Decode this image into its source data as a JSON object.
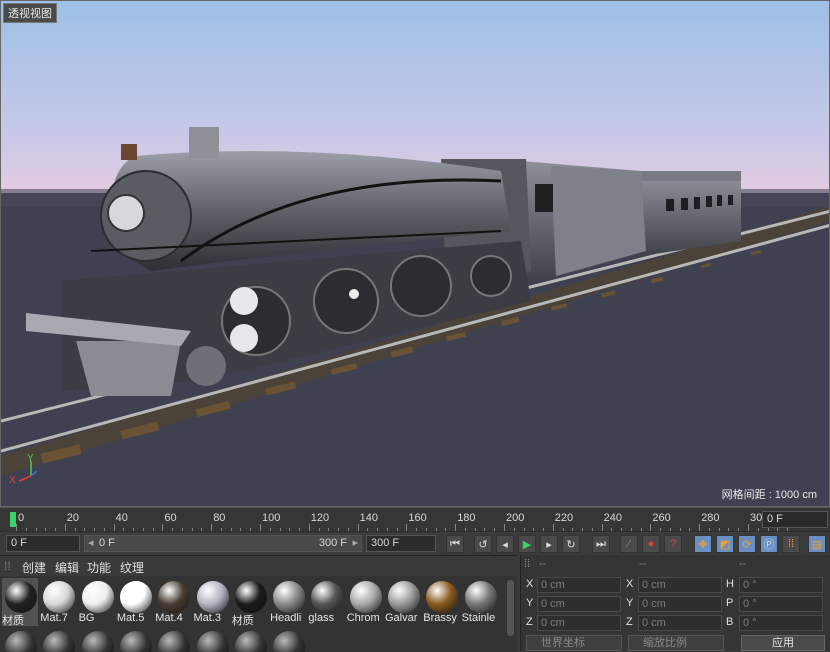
{
  "viewport": {
    "tab_label": "透视视图",
    "grid_spacing": "网格间距 : 1000 cm",
    "axis_x": "X",
    "axis_y": "Y",
    "colors": {
      "sky_top": "#9fc0e6",
      "sky_bottom": "#d8c7e3",
      "ground": "#3f4050"
    }
  },
  "timeline": {
    "ticks": [
      "0",
      "20",
      "40",
      "60",
      "80",
      "100",
      "120",
      "140",
      "160",
      "180",
      "200",
      "220",
      "240",
      "260",
      "280",
      "30"
    ],
    "current_frame": "0 F"
  },
  "transport": {
    "start_frame": "0 F",
    "range_start": "0 F",
    "range_end": "300 F",
    "end_frame": "300 F"
  },
  "materials": {
    "menu": [
      "创建",
      "编辑",
      "功能",
      "纹理"
    ],
    "items": [
      {
        "label": "材质",
        "color": "#222222"
      },
      {
        "label": "Mat.7",
        "color": "#d8d8d8"
      },
      {
        "label": "BG",
        "color": "#eeeeee"
      },
      {
        "label": "Mat.5",
        "color": "#ffffff"
      },
      {
        "label": "Mat.4",
        "color": "#4a3e33"
      },
      {
        "label": "Mat.3",
        "color": "#b4b4c4"
      },
      {
        "label": "材质",
        "color": "#1b1b1b"
      },
      {
        "label": "Headli",
        "color": "#8a8a8a"
      },
      {
        "label": "glass",
        "color": "#555555"
      },
      {
        "label": "Chrom",
        "color": "#a8a8a8"
      },
      {
        "label": "Galvar",
        "color": "#9a9a9a"
      },
      {
        "label": "Brassy",
        "color": "#8a5a1e"
      },
      {
        "label": "Stainle",
        "color": "#777777"
      }
    ],
    "second_row_count": 8
  },
  "coords": {
    "headers": [
      "--",
      "--",
      "--"
    ],
    "rows": [
      {
        "l1": "X",
        "v1": "0 cm",
        "l2": "X",
        "v2": "0 cm",
        "l3": "H",
        "v3": "0 °"
      },
      {
        "l1": "Y",
        "v1": "0 cm",
        "l2": "Y",
        "v2": "0 cm",
        "l3": "P",
        "v3": "0 °"
      },
      {
        "l1": "Z",
        "v1": "0 cm",
        "l2": "Z",
        "v2": "0 cm",
        "l3": "B",
        "v3": "0 °"
      }
    ],
    "coord_system": "世界坐标",
    "scale_mode": "缩放比例",
    "apply": "应用"
  }
}
